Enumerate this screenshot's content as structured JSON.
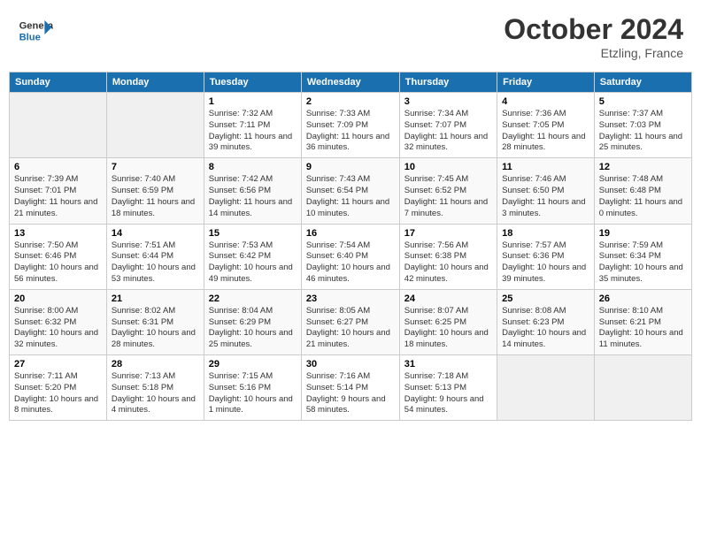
{
  "header": {
    "logo_text_general": "General",
    "logo_text_blue": "Blue",
    "month_year": "October 2024",
    "location": "Etzling, France"
  },
  "days_of_week": [
    "Sunday",
    "Monday",
    "Tuesday",
    "Wednesday",
    "Thursday",
    "Friday",
    "Saturday"
  ],
  "weeks": [
    [
      {
        "day": "",
        "info": ""
      },
      {
        "day": "",
        "info": ""
      },
      {
        "day": "1",
        "info": "Sunrise: 7:32 AM\nSunset: 7:11 PM\nDaylight: 11 hours and 39 minutes."
      },
      {
        "day": "2",
        "info": "Sunrise: 7:33 AM\nSunset: 7:09 PM\nDaylight: 11 hours and 36 minutes."
      },
      {
        "day": "3",
        "info": "Sunrise: 7:34 AM\nSunset: 7:07 PM\nDaylight: 11 hours and 32 minutes."
      },
      {
        "day": "4",
        "info": "Sunrise: 7:36 AM\nSunset: 7:05 PM\nDaylight: 11 hours and 28 minutes."
      },
      {
        "day": "5",
        "info": "Sunrise: 7:37 AM\nSunset: 7:03 PM\nDaylight: 11 hours and 25 minutes."
      }
    ],
    [
      {
        "day": "6",
        "info": "Sunrise: 7:39 AM\nSunset: 7:01 PM\nDaylight: 11 hours and 21 minutes."
      },
      {
        "day": "7",
        "info": "Sunrise: 7:40 AM\nSunset: 6:59 PM\nDaylight: 11 hours and 18 minutes."
      },
      {
        "day": "8",
        "info": "Sunrise: 7:42 AM\nSunset: 6:56 PM\nDaylight: 11 hours and 14 minutes."
      },
      {
        "day": "9",
        "info": "Sunrise: 7:43 AM\nSunset: 6:54 PM\nDaylight: 11 hours and 10 minutes."
      },
      {
        "day": "10",
        "info": "Sunrise: 7:45 AM\nSunset: 6:52 PM\nDaylight: 11 hours and 7 minutes."
      },
      {
        "day": "11",
        "info": "Sunrise: 7:46 AM\nSunset: 6:50 PM\nDaylight: 11 hours and 3 minutes."
      },
      {
        "day": "12",
        "info": "Sunrise: 7:48 AM\nSunset: 6:48 PM\nDaylight: 11 hours and 0 minutes."
      }
    ],
    [
      {
        "day": "13",
        "info": "Sunrise: 7:50 AM\nSunset: 6:46 PM\nDaylight: 10 hours and 56 minutes."
      },
      {
        "day": "14",
        "info": "Sunrise: 7:51 AM\nSunset: 6:44 PM\nDaylight: 10 hours and 53 minutes."
      },
      {
        "day": "15",
        "info": "Sunrise: 7:53 AM\nSunset: 6:42 PM\nDaylight: 10 hours and 49 minutes."
      },
      {
        "day": "16",
        "info": "Sunrise: 7:54 AM\nSunset: 6:40 PM\nDaylight: 10 hours and 46 minutes."
      },
      {
        "day": "17",
        "info": "Sunrise: 7:56 AM\nSunset: 6:38 PM\nDaylight: 10 hours and 42 minutes."
      },
      {
        "day": "18",
        "info": "Sunrise: 7:57 AM\nSunset: 6:36 PM\nDaylight: 10 hours and 39 minutes."
      },
      {
        "day": "19",
        "info": "Sunrise: 7:59 AM\nSunset: 6:34 PM\nDaylight: 10 hours and 35 minutes."
      }
    ],
    [
      {
        "day": "20",
        "info": "Sunrise: 8:00 AM\nSunset: 6:32 PM\nDaylight: 10 hours and 32 minutes."
      },
      {
        "day": "21",
        "info": "Sunrise: 8:02 AM\nSunset: 6:31 PM\nDaylight: 10 hours and 28 minutes."
      },
      {
        "day": "22",
        "info": "Sunrise: 8:04 AM\nSunset: 6:29 PM\nDaylight: 10 hours and 25 minutes."
      },
      {
        "day": "23",
        "info": "Sunrise: 8:05 AM\nSunset: 6:27 PM\nDaylight: 10 hours and 21 minutes."
      },
      {
        "day": "24",
        "info": "Sunrise: 8:07 AM\nSunset: 6:25 PM\nDaylight: 10 hours and 18 minutes."
      },
      {
        "day": "25",
        "info": "Sunrise: 8:08 AM\nSunset: 6:23 PM\nDaylight: 10 hours and 14 minutes."
      },
      {
        "day": "26",
        "info": "Sunrise: 8:10 AM\nSunset: 6:21 PM\nDaylight: 10 hours and 11 minutes."
      }
    ],
    [
      {
        "day": "27",
        "info": "Sunrise: 7:11 AM\nSunset: 5:20 PM\nDaylight: 10 hours and 8 minutes."
      },
      {
        "day": "28",
        "info": "Sunrise: 7:13 AM\nSunset: 5:18 PM\nDaylight: 10 hours and 4 minutes."
      },
      {
        "day": "29",
        "info": "Sunrise: 7:15 AM\nSunset: 5:16 PM\nDaylight: 10 hours and 1 minute."
      },
      {
        "day": "30",
        "info": "Sunrise: 7:16 AM\nSunset: 5:14 PM\nDaylight: 9 hours and 58 minutes."
      },
      {
        "day": "31",
        "info": "Sunrise: 7:18 AM\nSunset: 5:13 PM\nDaylight: 9 hours and 54 minutes."
      },
      {
        "day": "",
        "info": ""
      },
      {
        "day": "",
        "info": ""
      }
    ]
  ]
}
